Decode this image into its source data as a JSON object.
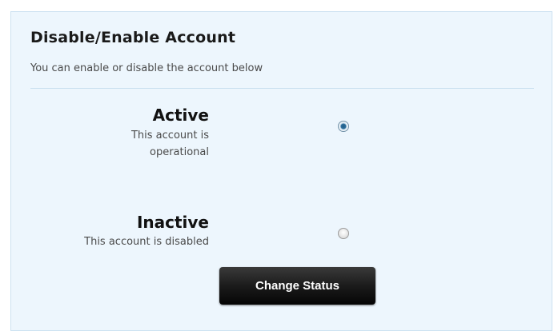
{
  "section": {
    "title": "Disable/Enable Account",
    "subtitle": "You can enable or disable the account below"
  },
  "options": [
    {
      "label": "Active",
      "description": "This account is operational",
      "selected": true
    },
    {
      "label": "Inactive",
      "description": "This account is disabled",
      "selected": false
    }
  ],
  "actions": {
    "change_status_label": "Change Status"
  },
  "colors": {
    "panel_background": "#edf6fd",
    "divider": "#c9e0ef",
    "button_background": "#1b1b1b",
    "button_text": "#ffffff"
  }
}
